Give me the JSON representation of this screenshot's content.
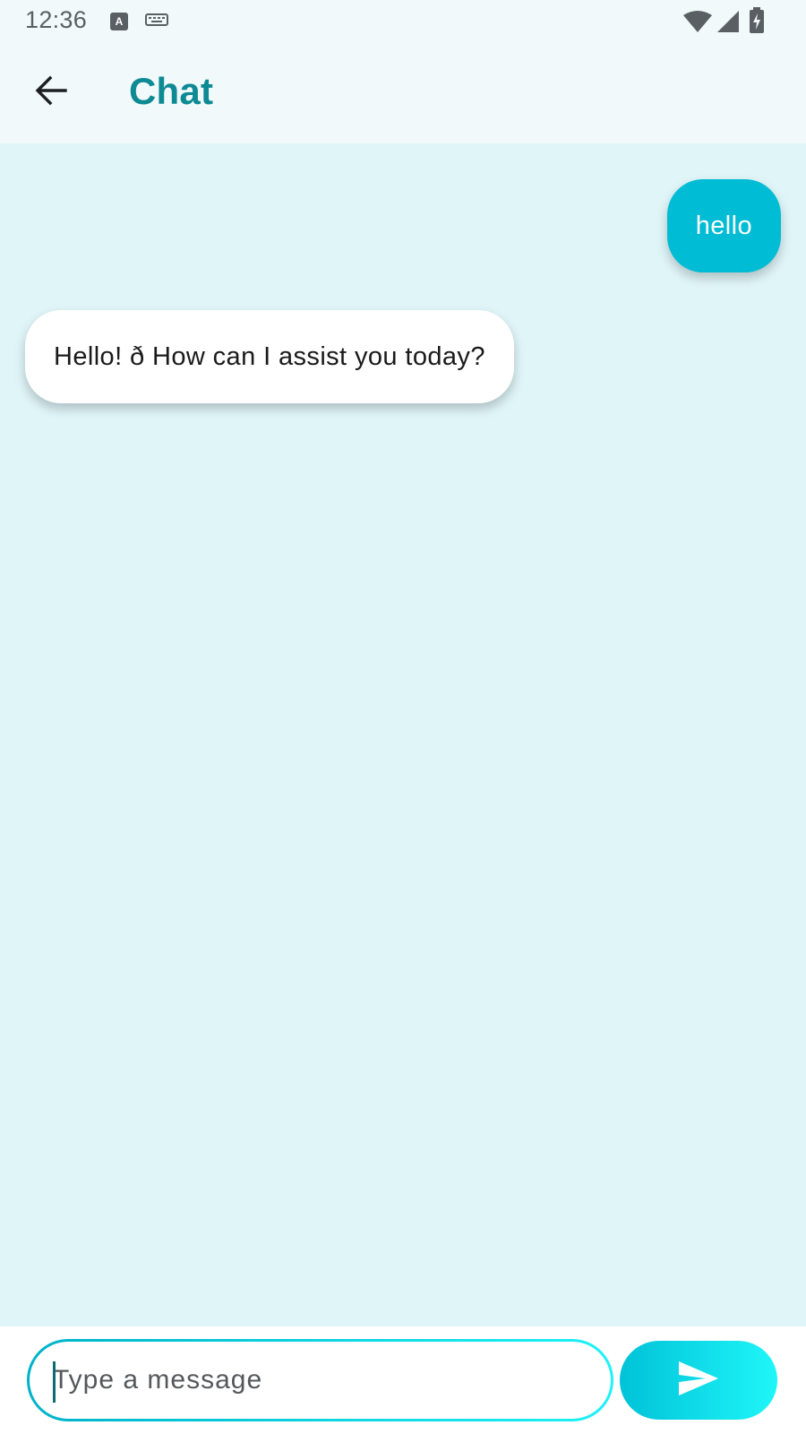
{
  "status_bar": {
    "time": "12:36",
    "icons": [
      "text-a-notification-icon",
      "keyboard-icon",
      "wifi-icon",
      "cell-signal-icon",
      "battery-charging-icon"
    ]
  },
  "app_bar": {
    "title": "Chat",
    "back_icon": "arrow-back-icon"
  },
  "messages": [
    {
      "sender": "user",
      "text": "hello"
    },
    {
      "sender": "bot",
      "text": "Hello! ð How can I assist you today?"
    }
  ],
  "composer": {
    "placeholder": "Type a message",
    "value": "",
    "send_icon": "send-icon"
  },
  "colors": {
    "accent": "#00bcd4",
    "title": "#0d8a94",
    "chat_background": "#dff5f8",
    "app_bar_background": "#f2f9fb"
  }
}
